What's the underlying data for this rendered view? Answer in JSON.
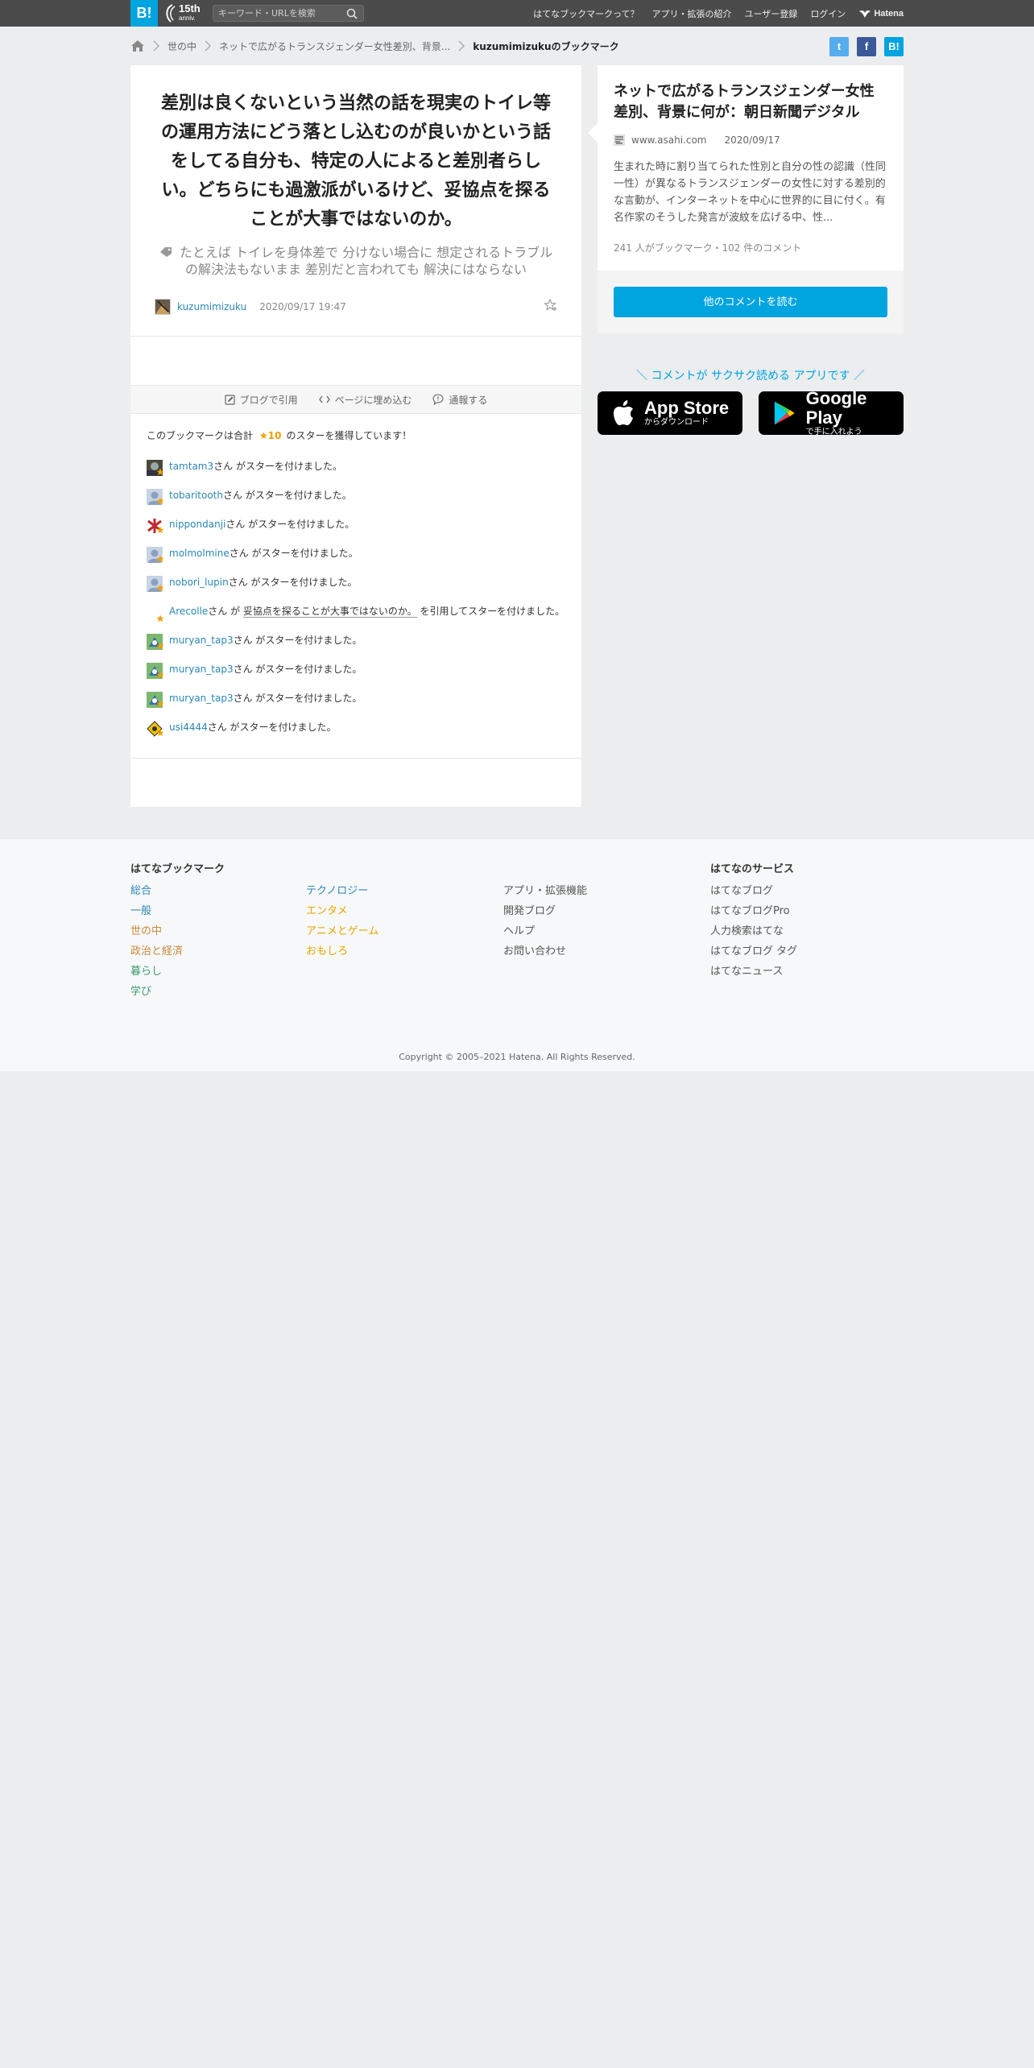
{
  "header": {
    "logo_b": "B!",
    "logo_15th": "15th",
    "logo_anniv": "anniv.",
    "search_placeholder": "キーワード・URLを検索",
    "nav": [
      "はてなブックマークって？",
      "アプリ・拡張の紹介",
      "ユーザー登録",
      "ログイン"
    ],
    "hatena_logo": "Hatena"
  },
  "breadcrumb": {
    "items": [
      "世の中",
      "ネットで広がるトランスジェンダー女性差別、背景...",
      "kuzumimizukuのブックマーク"
    ]
  },
  "share": {
    "twitter": "t",
    "facebook": "f",
    "hatena": "B!"
  },
  "bookmark": {
    "comment": "差別は良くないという当然の話を現実のトイレ等の運用方法にどう落とし込むのが良いかという話をしてる自分も、特定の人によると差別者らしい。どちらにも過激派がいるけど、妥協点を探ることが大事ではないのか。",
    "tags_line1": "たとえば トイレを身体差で 分けない場合に 想定されるトラブル",
    "tags_line2": "の解決法もないまま 差別だと言われても 解決にはならない",
    "user": "kuzumimizuku",
    "date": "2020/09/17 19:47"
  },
  "actions": [
    "ブログで引用",
    "ページに埋め込む",
    "通報する"
  ],
  "stars": {
    "summary_prefix": "このブックマークは合計",
    "count": "★10",
    "summary_suffix": "のスターを獲得しています！",
    "rows": [
      {
        "user": "tamtam3",
        "text": "さん がスターを付けました。"
      },
      {
        "user": "tobaritooth",
        "text": "さん がスターを付けました。"
      },
      {
        "user": "nippondanji",
        "text": "さん がスターを付けました。"
      },
      {
        "user": "molmolmine",
        "text": "さん がスターを付けました。"
      },
      {
        "user": "nobori_lupin",
        "text": "さん がスターを付けました。"
      },
      {
        "user": "Arecolle",
        "text_pre": "さん が ",
        "quote": "妥協点を探ることが大事ではないのか。",
        "text_post": " を引用してスターを付けました。"
      },
      {
        "user": "muryan_tap3",
        "text": "さん がスターを付けました。"
      },
      {
        "user": "muryan_tap3",
        "text": "さん がスターを付けました。"
      },
      {
        "user": "muryan_tap3",
        "text": "さん がスターを付けました。"
      },
      {
        "user": "usi4444",
        "text": "さん がスターを付けました。"
      }
    ]
  },
  "entry": {
    "title": "ネットで広がるトランスジェンダー女性差別、背景に何が：朝日新聞デジタル",
    "domain": "www.asahi.com",
    "date": "2020/09/17",
    "description": "生まれた時に割り当てられた性別と自分の性の認識（性同一性）が異なるトランスジェンダーの女性に対する差別的な言動が、インターネットを中心に世界的に目に付く。有名作家のそうした発言が波紋を広げる中、性...",
    "stats": "241 人がブックマーク・102 件のコメント",
    "button": "他のコメントを読む"
  },
  "app_promo": {
    "text": "＼ コメントが サクサク読める アプリです ／",
    "appstore_big": "App Store",
    "appstore_small": "からダウンロード",
    "googleplay_big": "Google Play",
    "googleplay_small": "で手に入れよう"
  },
  "footer": {
    "bookmark_heading": "はてなブックマーク",
    "categories_col1": [
      {
        "label": "総合",
        "color": "#2a87b5"
      },
      {
        "label": "一般",
        "color": "#2a87b5"
      },
      {
        "label": "世の中",
        "color": "#c8883c"
      },
      {
        "label": "政治と経済",
        "color": "#c8883c"
      },
      {
        "label": "暮らし",
        "color": "#3a9a6e"
      },
      {
        "label": "学び",
        "color": "#3a9a6e"
      }
    ],
    "categories_col2": [
      {
        "label": "テクノロジー",
        "color": "#2a87b5"
      },
      {
        "label": "エンタメ",
        "color": "#e5a800"
      },
      {
        "label": "アニメとゲーム",
        "color": "#e5a800"
      },
      {
        "label": "おもしろ",
        "color": "#e5a800"
      }
    ],
    "links_col3": [
      "アプリ・拡張機能",
      "開発ブログ",
      "ヘルプ",
      "お問い合わせ"
    ],
    "services_heading": "はてなのサービス",
    "services": [
      "はてなブログ",
      "はてなブログPro",
      "人力検索はてな",
      "はてなブログ タグ",
      "はてなニュース"
    ],
    "copyright": "Copyright © 2005–2021 Hatena. All Rights Reserved."
  },
  "colors": {
    "accent": "#00a4de",
    "link": "#2a87b5",
    "star": "#f0a000",
    "twitter": "#55acee",
    "facebook": "#3b5998"
  }
}
